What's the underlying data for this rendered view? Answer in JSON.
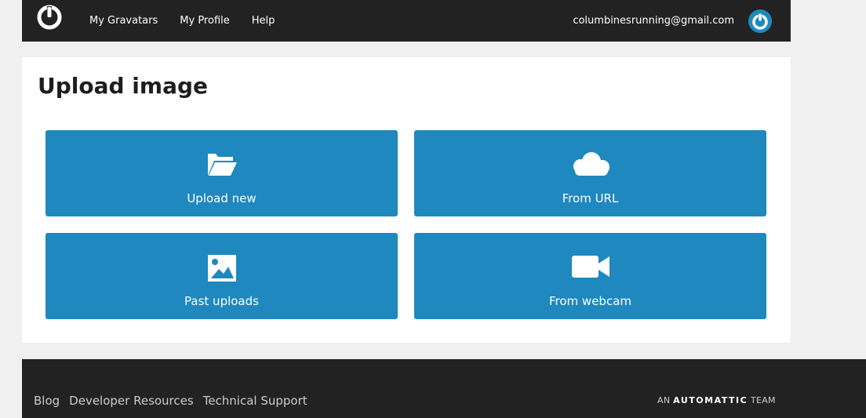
{
  "header": {
    "nav": [
      {
        "label": "My Gravatars"
      },
      {
        "label": "My Profile"
      },
      {
        "label": "Help"
      }
    ],
    "email": "columbinesrunning@gmail.com",
    "logo_icon": "gravatar-power-icon",
    "avatar_icon": "gravatar-avatar-icon",
    "accent_color": "#1e88bf"
  },
  "main": {
    "title": "Upload image",
    "options": [
      {
        "label": "Upload new",
        "icon": "folder-open-icon"
      },
      {
        "label": "From URL",
        "icon": "cloud-icon"
      },
      {
        "label": "Past uploads",
        "icon": "image-icon"
      },
      {
        "label": "From webcam",
        "icon": "video-camera-icon"
      }
    ]
  },
  "footer": {
    "links": [
      {
        "label": "Blog"
      },
      {
        "label": "Developer Resources"
      },
      {
        "label": "Technical Support"
      }
    ],
    "team_prefix": "AN",
    "team_brand": "AUTOMATTIC",
    "team_suffix": "TEAM"
  }
}
